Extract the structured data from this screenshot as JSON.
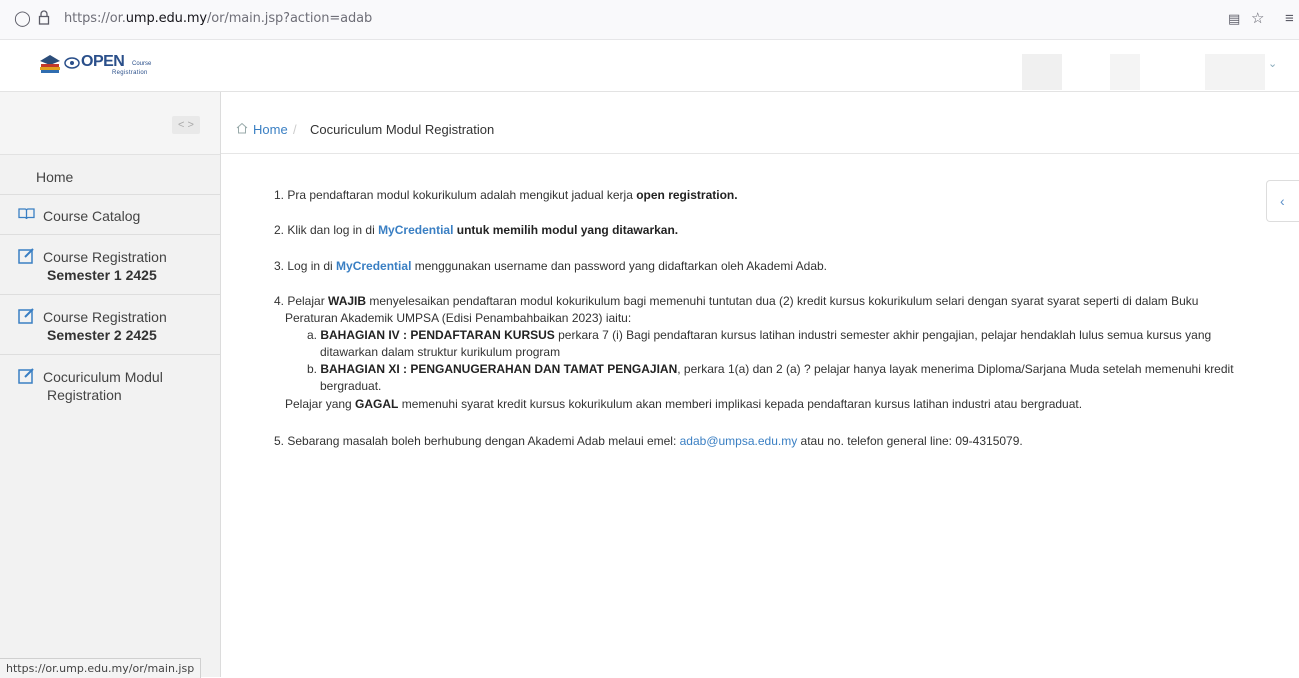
{
  "browser": {
    "url_prefix": "https://or.",
    "url_host": "ump.edu.my",
    "url_path": "/or/main.jsp?action=adab",
    "icons": [
      "shield-icon",
      "lock-icon",
      "reader-icon",
      "star-icon",
      "menu-icon"
    ]
  },
  "header": {
    "logo_open": "OPEN",
    "logo_course": "Course",
    "logo_registration": "Registration"
  },
  "sidebar": {
    "toggle": "< >",
    "home": "Home",
    "items": [
      {
        "label": "Course Catalog",
        "icon": "book-icon"
      },
      {
        "label": "Course Registration",
        "sub": "Semester 1 2425",
        "icon": "edit-icon"
      },
      {
        "label": "Course Registration",
        "sub": "Semester 2 2425",
        "icon": "edit-icon"
      },
      {
        "label1": "Cocuriculum Modul",
        "label2": "Registration",
        "icon": "edit-icon"
      }
    ]
  },
  "breadcrumb": {
    "home": "Home",
    "separator": "/",
    "current": "Cocuriculum Modul Registration"
  },
  "content": {
    "item1_text": "1. Pra pendaftaran modul kokurikulum adalah mengikut jadual kerja ",
    "item1_bold": "open registration.",
    "item2_pre": "2. Klik dan log in di ",
    "item2_link": "MyCredential",
    "item2_bold": " untuk memilih modul yang ditawarkan.",
    "item3_pre": "3. Log in di ",
    "item3_link": "MyCredential",
    "item3_post": " menggunakan username dan password yang didaftarkan oleh Akademi Adab.",
    "item4_pre": "4. Pelajar ",
    "item4_bold": "WAJIB",
    "item4_post": " menyelesaikan pendaftaran modul kokurikulum bagi memenuhi tuntutan dua (2) kredit kursus kokurikulum selari dengan syarat syarat seperti di dalam Buku",
    "item4_line2": "Peraturan Akademik UMPSA (Edisi Penambahbaikan 2023) iaitu:",
    "item4a_pre": "a. ",
    "item4a_bold": "BAHAGIAN IV : PENDAFTARAN KURSUS",
    "item4a_post": " perkara 7 (i) Bagi pendaftaran kursus latihan industri semester akhir pengajian, pelajar hendaklah lulus semua kursus yang",
    "item4a_line2": "ditawarkan dalam struktur kurikulum program",
    "item4b_pre": "b. ",
    "item4b_bold": "BAHAGIAN XI : PENGANUGERAHAN DAN TAMAT PENGAJIAN",
    "item4b_post": ", perkara 1(a) dan 2 (a) ? pelajar hanya layak menerima Diploma/Sarjana Muda setelah memenuhi kredit",
    "item4b_line2": "bergraduat.",
    "item4_note_pre": "Pelajar yang ",
    "item4_note_bold": "GAGAL",
    "item4_note_post": " memenuhi syarat kredit kursus kokurikulum akan memberi implikasi kepada pendaftaran kursus latihan industri atau bergraduat.",
    "item5_pre": "5. Sebarang masalah boleh berhubung dengan Akademi Adab melaui emel: ",
    "item5_email": "adab@umpsa.edu.my",
    "item5_post": " atau no. telefon general line: 09-4315079."
  },
  "status_bar": "https://or.ump.edu.my/or/main.jsp"
}
